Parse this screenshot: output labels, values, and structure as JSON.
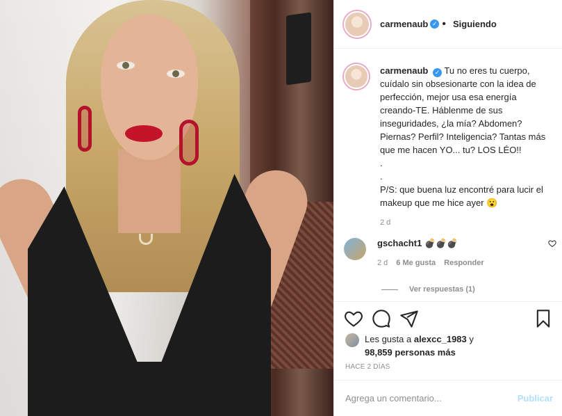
{
  "post": {
    "username": "carmenaub",
    "verified_mark": "✓",
    "follow_sep": "•",
    "follow_status": "Siguiendo"
  },
  "caption": {
    "username": "carmenaub",
    "text": "Tu no eres tu cuerpo, cuídalo sin obsesionarte con la idea de perfección, mejor usa esa energía creando-TE. Háblenme de sus inseguridades, ¿la mía? Abdomen? Piernas? Perfil? Inteligencia? Tantas más que me hacen YO... tu? LOS LÉO!!\n.\n.\nP/S: que buena luz encontré para lucir el makeup que me hice ayer 😮",
    "age": "2 d"
  },
  "comment": {
    "username": "gschacht1",
    "text": "💣💣💣",
    "age": "2 d",
    "likes": "6 Me gusta",
    "reply": "Responder"
  },
  "replies": {
    "label": "Ver respuestas (1)"
  },
  "likes": {
    "prefix": "Les gusta a",
    "user": "alexcc_1983",
    "joiner": "y",
    "count": "98,859 personas más"
  },
  "timestamp": "HACE 2 DÍAS",
  "add_comment": {
    "placeholder": "Agrega un comentario...",
    "post_label": "Publicar",
    "post_color": "#b2dffc"
  },
  "icons": {
    "like": "heart-icon",
    "comment": "comment-icon",
    "share": "share-icon",
    "save": "bookmark-icon"
  }
}
